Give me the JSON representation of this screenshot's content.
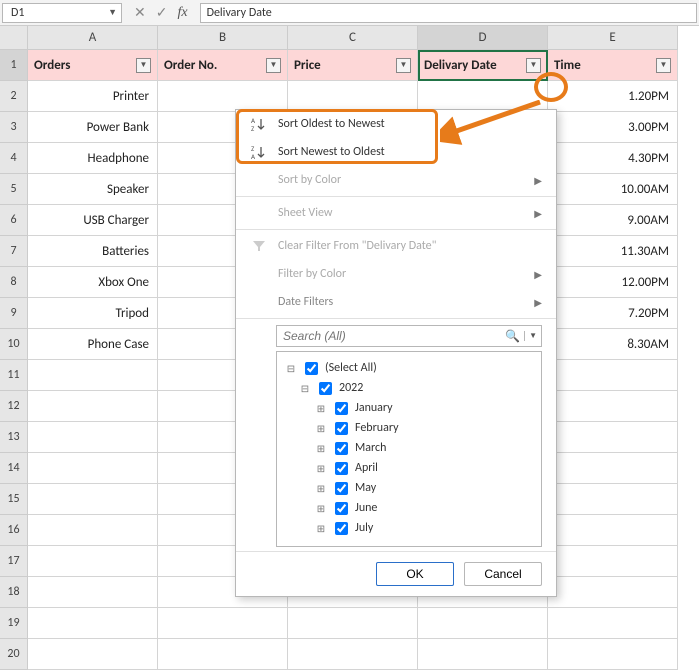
{
  "namebox": {
    "ref": "D1"
  },
  "formula_bar": {
    "value": "Delivary Date"
  },
  "columns": [
    "A",
    "B",
    "C",
    "D",
    "E"
  ],
  "headers": {
    "A": "Orders",
    "B": "Order No.",
    "C": "Price",
    "D": "Delivary Date",
    "E": "Time"
  },
  "active_column": "D",
  "active_row": 1,
  "chart_data": {
    "type": "table",
    "columns": [
      "Orders",
      "Order No.",
      "Price",
      "Delivary Date",
      "Time"
    ],
    "rows": [
      {
        "Orders": "Printer",
        "Time": "1.20PM"
      },
      {
        "Orders": "Power Bank",
        "Time": "3.00PM"
      },
      {
        "Orders": "Headphone",
        "Time": "4.30PM"
      },
      {
        "Orders": "Speaker",
        "Time": "10.00AM"
      },
      {
        "Orders": "USB Charger",
        "Time": "9.00AM"
      },
      {
        "Orders": "Batteries",
        "Time": "11.30AM"
      },
      {
        "Orders": "Xbox One",
        "Time": "12.00PM"
      },
      {
        "Orders": "Tripod",
        "Time": "7.20PM"
      },
      {
        "Orders": "Phone Case",
        "Time": "8.30AM"
      }
    ]
  },
  "menu": {
    "sort_asc": "Sort Oldest to Newest",
    "sort_desc": "Sort Newest to Oldest",
    "sort_color": "Sort by Color",
    "sheet_view": "Sheet View",
    "clear_filter": "Clear Filter From \"Delivary Date\"",
    "filter_color": "Filter by Color",
    "date_filters": "Date Filters",
    "search_placeholder": "Search (All)",
    "tree": {
      "select_all": "(Select All)",
      "year": "2022",
      "months": [
        "January",
        "February",
        "March",
        "April",
        "May",
        "June",
        "July"
      ]
    },
    "ok": "OK",
    "cancel": "Cancel"
  }
}
